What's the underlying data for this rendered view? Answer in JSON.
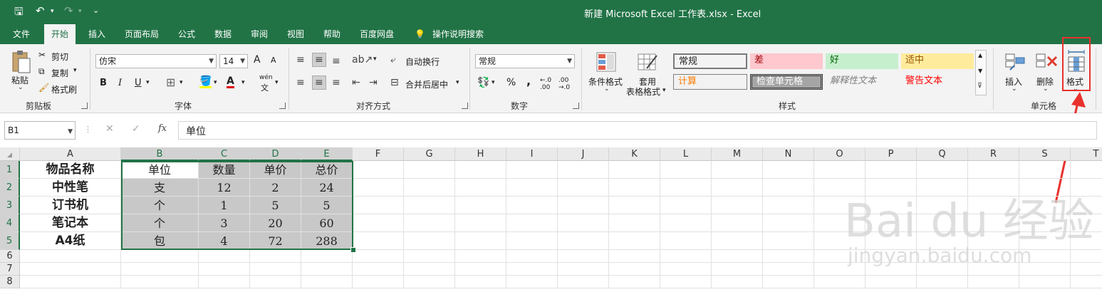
{
  "title": "新建 Microsoft Excel 工作表.xlsx  -  Excel",
  "quick_access": {
    "save": "🖫",
    "undo": "↶",
    "redo": "↷",
    "more": "⌄"
  },
  "tabs": [
    "文件",
    "开始",
    "插入",
    "页面布局",
    "公式",
    "数据",
    "审阅",
    "视图",
    "帮助",
    "百度网盘"
  ],
  "tell_me": "操作说明搜索",
  "clipboard": {
    "paste": "粘贴",
    "cut": "剪切",
    "copy": "复制",
    "format_painter": "格式刷",
    "label": "剪贴板"
  },
  "font": {
    "name": "仿宋",
    "size": "14",
    "bold": "B",
    "italic": "I",
    "underline": "U",
    "grow": "A",
    "shrink": "A",
    "label": "字体",
    "wen": "文"
  },
  "alignment": {
    "wrap": "自动换行",
    "merge": "合并后居中",
    "label": "对齐方式"
  },
  "number": {
    "format": "常规",
    "percent": "%",
    "comma": ",",
    "label": "数字"
  },
  "styles": {
    "conditional": "条件格式",
    "table_format_1": "套用",
    "table_format_2": "表格格式",
    "label": "样式",
    "gallery": [
      {
        "label": "常规",
        "bg": "#ffffff",
        "fg": "#222222"
      },
      {
        "label": "差",
        "bg": "#ffc7ce",
        "fg": "#9c0006"
      },
      {
        "label": "好",
        "bg": "#c6efce",
        "fg": "#006100"
      },
      {
        "label": "适中",
        "bg": "#ffeb9c",
        "fg": "#9c5700"
      },
      {
        "label": "计算",
        "bg": "#f2f2f2",
        "fg": "#fa7d00"
      },
      {
        "label": "检查单元格",
        "bg": "#a5a5a5",
        "fg": "#ffffff"
      },
      {
        "label": "解释性文本",
        "bg": "#f3f3f3",
        "fg": "#7f7f7f"
      },
      {
        "label": "警告文本",
        "bg": "#f3f3f3",
        "fg": "#ff0000"
      }
    ]
  },
  "cells_group": {
    "insert": "插入",
    "delete": "删除",
    "format": "格式",
    "label": "单元格"
  },
  "name_box": "B1",
  "formula": {
    "cancel": "✕",
    "enter": "✓",
    "fx": "fx",
    "value": "单位"
  },
  "columns": [
    "A",
    "B",
    "C",
    "D",
    "E",
    "F",
    "G",
    "H",
    "I",
    "J",
    "K",
    "L",
    "M",
    "N",
    "O",
    "P",
    "Q",
    "R",
    "S",
    "T"
  ],
  "rows": [
    "1",
    "2",
    "3",
    "4",
    "5",
    "6",
    "7",
    "8"
  ],
  "table": [
    [
      "物品名称",
      "单位",
      "数量",
      "单价",
      "总价"
    ],
    [
      "中性笔",
      "支",
      "12",
      "2",
      "24"
    ],
    [
      "订书机",
      "个",
      "1",
      "5",
      "5"
    ],
    [
      "笔记本",
      "个",
      "3",
      "20",
      "60"
    ],
    [
      "A4纸",
      "包",
      "4",
      "72",
      "288"
    ]
  ],
  "watermark": {
    "brand": "Bai du 经验",
    "url": "jingyan.baidu.com"
  },
  "colors": {
    "excel_green": "#217346",
    "annotation_red": "#e8312d"
  }
}
